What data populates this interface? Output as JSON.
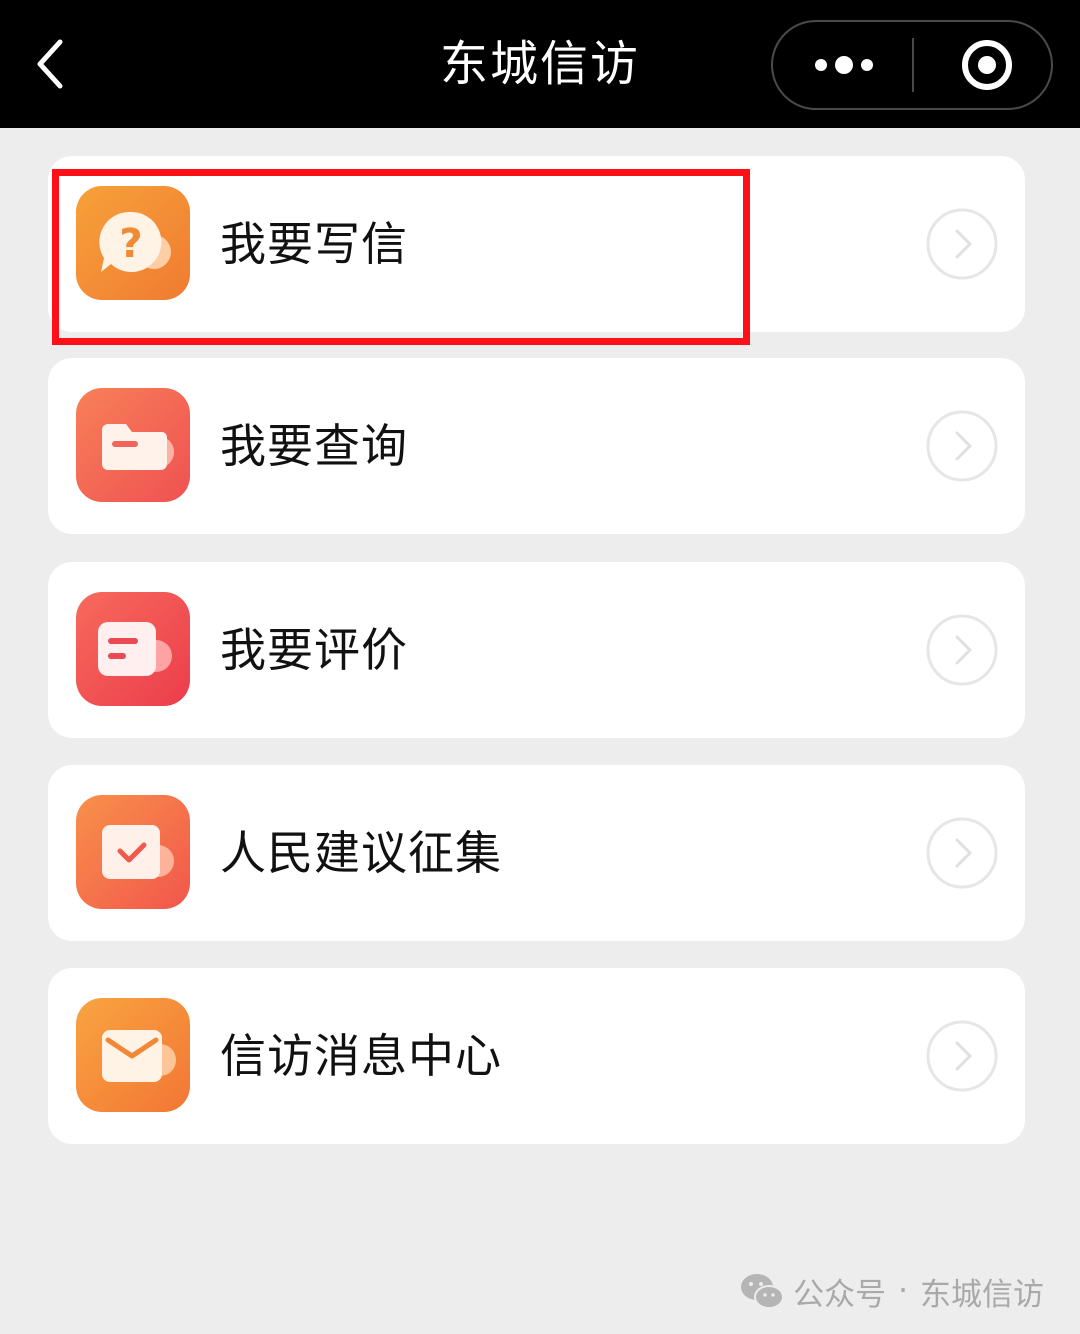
{
  "header": {
    "title": "东城信访",
    "back_icon": "chevron-left-icon",
    "more_icon": "more-dots-icon",
    "close_icon": "target-close-icon"
  },
  "menu": {
    "items": [
      {
        "label": "我要写信",
        "icon": "question-bubble-icon",
        "highlighted": true
      },
      {
        "label": "我要查询",
        "icon": "folder-icon",
        "highlighted": false
      },
      {
        "label": "我要评价",
        "icon": "comment-icon",
        "highlighted": false
      },
      {
        "label": "人民建议征集",
        "icon": "checkbox-icon",
        "highlighted": false
      },
      {
        "label": "信访消息中心",
        "icon": "mail-icon",
        "highlighted": false
      }
    ]
  },
  "colors": {
    "topbar": "#000000",
    "background": "#ededed",
    "highlight": "#ff0f17",
    "icon_orange": "#f7a13a",
    "icon_red": "#ec3d4c"
  },
  "watermark": {
    "source": "公众号",
    "separator": "·",
    "account": "东城信访",
    "icon": "wechat-icon"
  }
}
